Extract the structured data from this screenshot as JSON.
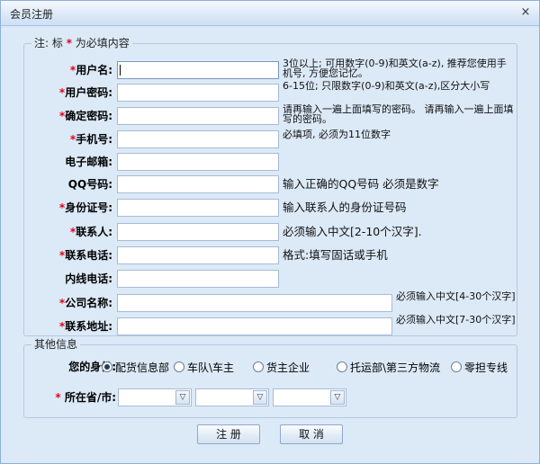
{
  "window": {
    "title": "会员注册",
    "close_glyph": "×"
  },
  "required_group": {
    "legend_prefix": "注: 标",
    "legend_star": "*",
    "legend_suffix": "为必填内容"
  },
  "fields": [
    {
      "label": "用户名:",
      "required": true,
      "value": "",
      "hint": "3位以上; 可用数字(0-9)和英文(a-z), 推荐您使用手机号, 方便您记忆。",
      "hint_style": "small"
    },
    {
      "label": "用户密码:",
      "required": true,
      "value": "",
      "hint": "6-15位; 只限数字(0-9)和英文(a-z),区分大小写",
      "hint_style": "small"
    },
    {
      "label": "确定密码:",
      "required": true,
      "value": "",
      "hint": "请再输入一遍上面填写的密码。 请再输入一遍上面填写的密码。",
      "hint_style": "small"
    },
    {
      "label": "手机号:",
      "required": true,
      "value": "",
      "hint": "必填项, 必须为11位数字",
      "hint_style": "small"
    },
    {
      "label": "电子邮箱:",
      "required": false,
      "value": "",
      "hint": "",
      "hint_style": "small"
    },
    {
      "label": "QQ号码:",
      "required": false,
      "value": "",
      "hint": "输入正确的QQ号码 必须是数字",
      "hint_style": "big"
    },
    {
      "label": "身份证号:",
      "required": true,
      "value": "",
      "hint": "输入联系人的身份证号码",
      "hint_style": "big"
    },
    {
      "label": "联系人:",
      "required": true,
      "value": "",
      "hint": "必须输入中文[2-10个汉字].",
      "hint_style": "big"
    },
    {
      "label": "联系电话:",
      "required": true,
      "value": "",
      "hint": "格式:填写固话或手机",
      "hint_style": "big"
    },
    {
      "label": "内线电话:",
      "required": false,
      "value": "",
      "hint": "",
      "hint_style": "big"
    },
    {
      "label": "公司名称:",
      "required": true,
      "value": "",
      "hint": "必须输入中文[4-30个汉字]",
      "hint_style": "small"
    },
    {
      "label": "联系地址:",
      "required": true,
      "value": "",
      "hint": "必须输入中文[7-30个汉字]",
      "hint_style": "small"
    }
  ],
  "other_group": {
    "legend": "其他信息",
    "identity_label": "您的身份:",
    "identity_options": [
      "配货信息部",
      "车队\\车主",
      "货主企业",
      "托运部\\第三方物流",
      "零担专线"
    ],
    "identity_selected": 0,
    "region_label": "所在省/市:",
    "region_star": "*",
    "region_selects": [
      "",
      "",
      ""
    ],
    "arrow_glyph": "▽"
  },
  "buttons": {
    "register": "注 册",
    "cancel": "取 消"
  }
}
